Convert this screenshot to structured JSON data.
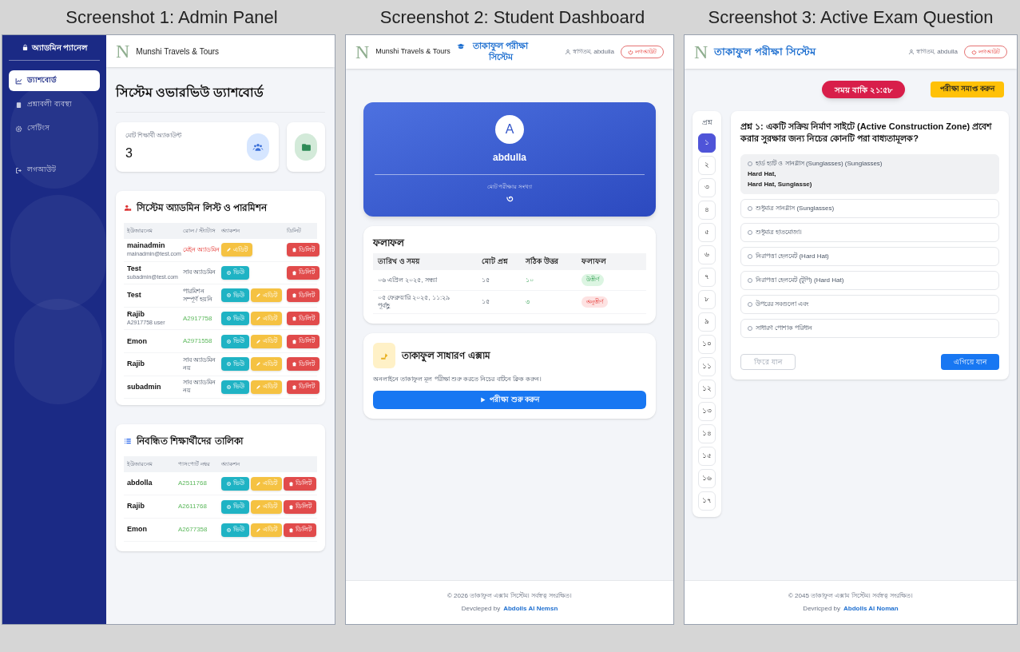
{
  "titles": [
    "Screenshot 1: Admin Panel",
    "Screenshot 2: Student Dashboard",
    "Screenshot 3: Active Exam Question"
  ],
  "admin_panel": {
    "sidebar": {
      "title": "অ্যাডমিন প্যানেল",
      "items": [
        {
          "label": "ড্যাশবোর্ড",
          "kind": "chart",
          "selected": true
        },
        {
          "label": "প্রশ্নাবলী ব্যবস্থা",
          "kind": "list",
          "selected": false
        },
        {
          "label": "সেটিংস",
          "kind": "gear",
          "selected": false
        },
        {
          "label": "লগআউট",
          "kind": "logout",
          "selected": false
        }
      ]
    },
    "header": {
      "logo": "N",
      "brand": "Munshi Travels & Tours"
    },
    "heading": "সিস্টেম ওভারভিউ ড্যাশবোর্ড",
    "stat": {
      "label": "মোট শিক্ষার্থী অ্যাকাউন্ট",
      "value": "3"
    },
    "admins": {
      "title": "সিস্টেম অ্যাডমিন লিস্ট ও পারমিশন",
      "columns": [
        "ইউজারনেম",
        "রোল / স্ট্যাটাস",
        "অ্যাকশন",
        "ডিলিট"
      ],
      "rows": [
        {
          "name": "mainadmin",
          "sub": "mainadmin@test.com",
          "role": "মেইন অ্যাডমিন",
          "kind": "main",
          "actions": [
            {
              "kind": "edit",
              "label": "এডিট"
            }
          ],
          "delete": "ডিলিট"
        },
        {
          "name": "Test",
          "sub": "subadmin@test.com",
          "role": "সাব অ্যাডমিন",
          "kind": "role",
          "actions": [
            {
              "kind": "view",
              "label": "ভিউ"
            }
          ],
          "delete": "ডিলিট"
        },
        {
          "name": "Test",
          "role": "পারমিশন সম্পূর্ণ হয়নি",
          "kind": "role",
          "actions": [
            {
              "kind": "view",
              "label": "ভিউ"
            },
            {
              "kind": "edit",
              "label": "এডিট"
            }
          ],
          "delete": "ডিলিট"
        },
        {
          "name": "Rajib",
          "sub": "A2917758 user",
          "role": "A2917758",
          "kind": "passport",
          "actions": [
            {
              "kind": "view",
              "label": "ভিউ"
            },
            {
              "kind": "edit",
              "label": "এডিট"
            }
          ],
          "delete": "ডিলিট"
        },
        {
          "name": "Emon",
          "role": "A2971558",
          "kind": "passport",
          "actions": [
            {
              "kind": "view",
              "label": "ভিউ"
            },
            {
              "kind": "edit",
              "label": "এডিট"
            }
          ],
          "delete": "ডিলিট"
        },
        {
          "name": "Rajib",
          "role": "সাব অ্যাডমিন নয়",
          "kind": "role",
          "actions": [
            {
              "kind": "view",
              "label": "ভিউ"
            },
            {
              "kind": "edit",
              "label": "এডিট"
            }
          ],
          "delete": "ডিলিট"
        },
        {
          "name": "subadmin",
          "role": "সাব অ্যাডমিন নয়",
          "kind": "role",
          "actions": [
            {
              "kind": "view",
              "label": "ভিউ"
            },
            {
              "kind": "edit",
              "label": "এডিট"
            }
          ],
          "delete": "ডিলিট"
        }
      ]
    },
    "students": {
      "title": "নিবন্ধিত শিক্ষার্থীদের তালিকা",
      "columns": [
        "ইউজারনেম",
        "পাসপোর্ট নম্বর",
        "অ্যাকশন"
      ],
      "rows": [
        {
          "name": "abdolla",
          "passport": "A2511768",
          "actions": [
            {
              "kind": "view",
              "label": "ভিউ"
            },
            {
              "kind": "edit",
              "label": "এডিট"
            },
            {
              "kind": "delete",
              "label": "ডিলিট"
            }
          ]
        },
        {
          "name": "Rajib",
          "passport": "A2611768",
          "actions": [
            {
              "kind": "view",
              "label": "ভিউ"
            },
            {
              "kind": "edit",
              "label": "এডিট"
            },
            {
              "kind": "delete",
              "label": "ডিলিট"
            }
          ]
        },
        {
          "name": "Emon",
          "passport": "A2677358",
          "actions": [
            {
              "kind": "view",
              "label": "ভিউ"
            },
            {
              "kind": "edit",
              "label": "এডিট"
            },
            {
              "kind": "delete",
              "label": "ডিলিট"
            }
          ]
        }
      ]
    }
  },
  "student_dashboard": {
    "header": {
      "logo": "N",
      "brand": "Munshi Travels & Tours",
      "system_title": "তাকাফুল পরীক্ষা সিস্টেম",
      "welcome": "স্বাগতম, abdulla",
      "logout": "লগআউট"
    },
    "profile": {
      "initial": "A",
      "name": "abdulla",
      "label": "মোট পরীক্ষার সংখ্যা",
      "value": "৩"
    },
    "results": {
      "title": "ফলাফল",
      "columns": [
        "তারিখ ও সময়",
        "মোট প্রশ্ন",
        "সঠিক উত্তর",
        "ফলাফল"
      ],
      "rows": [
        {
          "date": "০৬ এপ্রিল ২০২৫, সন্ধ্যা",
          "total": "১৫",
          "correct": "১০",
          "status": "উত্তীর্ণ",
          "passed": true
        },
        {
          "date": "০৫ ফেব্রুয়ারি ২০২৫, ১১:২৯ পূর্বাহ্ণ",
          "total": "১৫",
          "correct": "৩",
          "status": "অনুত্তীর্ণ",
          "passed": false
        }
      ]
    },
    "exam": {
      "title": "তাকাফুল সাধারণ এক্সাম",
      "description": "অনলাইনে তাকাফুল মূল পরীক্ষা শুরু করতে নিচের বাটনে ক্লিক করুন।",
      "button": "পরীক্ষা শুরু করুন"
    },
    "footer": {
      "copyright": "© 2026 তাকাফুল এক্সাম সিস্টেম। সর্বস্বত্ব সংরক্ষিত।",
      "developed": "Devcleped by",
      "author": "Abdolls Al Nemsn"
    }
  },
  "exam_question": {
    "header": {
      "logo": "N",
      "system_title": "তাকাফুল পরীক্ষা সিস্টেম",
      "welcome": "স্বাগতম, abdulla",
      "logout": "লগআউট"
    },
    "timer": "সময় বাকি ২১:৫৮",
    "finish_button": "পরীক্ষা সমাপ্ত করুন",
    "nav": {
      "label": "প্রশ্ন",
      "items": [
        {
          "label": "১",
          "selected": true
        },
        {
          "label": "২",
          "selected": false
        },
        {
          "label": "৩",
          "selected": false
        },
        {
          "label": "৪",
          "selected": false
        },
        {
          "label": "৫",
          "selected": false
        },
        {
          "label": "৬",
          "selected": false
        },
        {
          "label": "৭",
          "selected": false
        },
        {
          "label": "৮",
          "selected": false
        },
        {
          "label": "৯",
          "selected": false
        },
        {
          "label": "১০",
          "selected": false
        },
        {
          "label": "১১",
          "selected": false
        },
        {
          "label": "১২",
          "selected": false
        },
        {
          "label": "১৩",
          "selected": false
        },
        {
          "label": "১৪",
          "selected": false
        },
        {
          "label": "১৫",
          "selected": false
        },
        {
          "label": "১৬",
          "selected": false
        },
        {
          "label": "১৭",
          "selected": false
        }
      ]
    },
    "question": "প্রশ্ন ১: একটি সক্রিয় নির্মাণ সাইটে (Active Construction Zone) প্রবেশ করার সুরক্ষার জন্য নিচের কোনটি পরা বাধ্যতামূলক?",
    "options": [
      {
        "lines": [
          "হার্ড হ্যাট ও সানগ্লাস (Sunglasses) (Sunglasses)",
          "Hard Hat,",
          "Hard Hat, Sunglasse)"
        ],
        "selected": true
      },
      {
        "lines": [
          "শুধুমাত্র সানগ্লাস (Sunglasses)"
        ],
        "selected": false
      },
      {
        "lines": [
          "শুধুমাত্র হাতমোজা।"
        ],
        "selected": false
      },
      {
        "lines": [
          "নিরাপত্তা হেলমেট (Hard Hat)"
        ],
        "selected": false
      },
      {
        "lines": [
          "নিরাপত্তা হেলমেট (টুপি) (Hard Hat)"
        ],
        "selected": false
      },
      {
        "lines": [
          "উপরের সবগুলো এবং"
        ],
        "selected": false
      },
      {
        "lines": [
          "সাধারণ পোশাক পরিধান"
        ],
        "selected": false
      }
    ],
    "prev": "ফিরে যান",
    "next": "এগিয়ে যান",
    "footer": {
      "copyright": "© 2045 তাকাফুল এক্সাম সিস্টেম। সর্বস্বত্ব সংরক্ষিত।",
      "developed": "Devricped by",
      "author": "Abdolls Al Noman"
    }
  }
}
